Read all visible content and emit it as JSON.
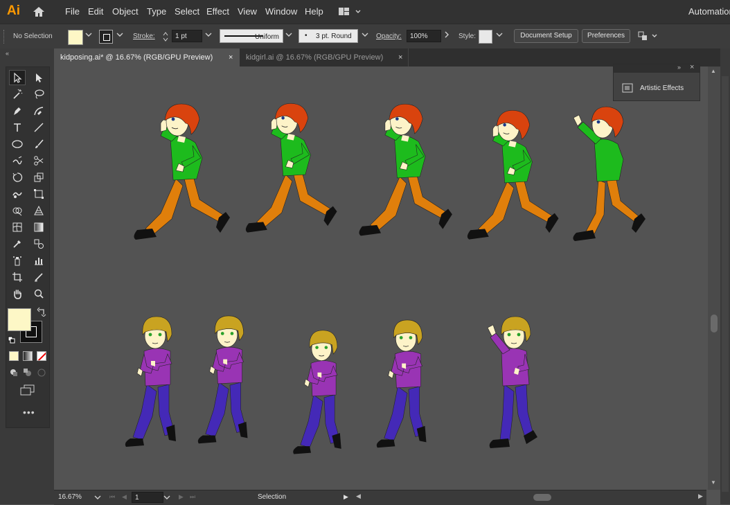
{
  "menubar": {
    "logo": "Ai",
    "items": [
      "File",
      "Edit",
      "Object",
      "Type",
      "Select",
      "Effect",
      "View",
      "Window",
      "Help"
    ],
    "right": "Automation"
  },
  "controlbar": {
    "selection": "No Selection",
    "fill_color": "#fdf7c6",
    "stroke_label": "Stroke:",
    "stroke_weight": "1 pt",
    "stroke_profile": "Uniform",
    "brush": "3 pt. Round",
    "opacity_label": "Opacity:",
    "opacity": "100%",
    "style_label": "Style:",
    "document_setup": "Document Setup",
    "preferences": "Preferences"
  },
  "tabs": [
    {
      "label": "kidposing.ai* @ 16.67% (RGB/GPU Preview)",
      "close": "×"
    },
    {
      "label": "kidgirl.ai @ 16.67% (RGB/GPU Preview)",
      "close": "×"
    }
  ],
  "panel": {
    "artistic_effects": "Artistic Effects"
  },
  "statusbar": {
    "zoom": "16.67%",
    "artboard": "1",
    "tool": "Selection"
  },
  "colors": {
    "fill": "#fdf7c6",
    "hair_red": "#d9430e",
    "shirt_green": "#1dbb1d",
    "pants_orange": "#e07f0b",
    "hair_blonde": "#c9a321",
    "shirt_purple": "#9934b4",
    "pants_blue": "#4429b7",
    "skin": "#fdf3c8",
    "shoes": "#111111"
  },
  "toolbar_icons": [
    "selection-tool-icon",
    "direct-selection-tool-icon",
    "magic-wand-tool-icon",
    "lasso-tool-icon",
    "pen-tool-icon",
    "curvature-tool-icon",
    "type-tool-icon",
    "line-segment-tool-icon",
    "ellipse-tool-icon",
    "paintbrush-tool-icon",
    "shaper-tool-icon",
    "scissors-tool-icon",
    "rotate-tool-icon",
    "scale-tool-icon",
    "warp-tool-icon",
    "free-transform-tool-icon",
    "shape-builder-tool-icon",
    "perspective-grid-tool-icon",
    "mesh-tool-icon",
    "gradient-tool-icon",
    "eyedropper-tool-icon",
    "blend-tool-icon",
    "symbol-sprayer-tool-icon",
    "column-graph-tool-icon",
    "artboard-tool-icon",
    "slice-tool-icon",
    "hand-tool-icon",
    "zoom-tool-icon"
  ]
}
